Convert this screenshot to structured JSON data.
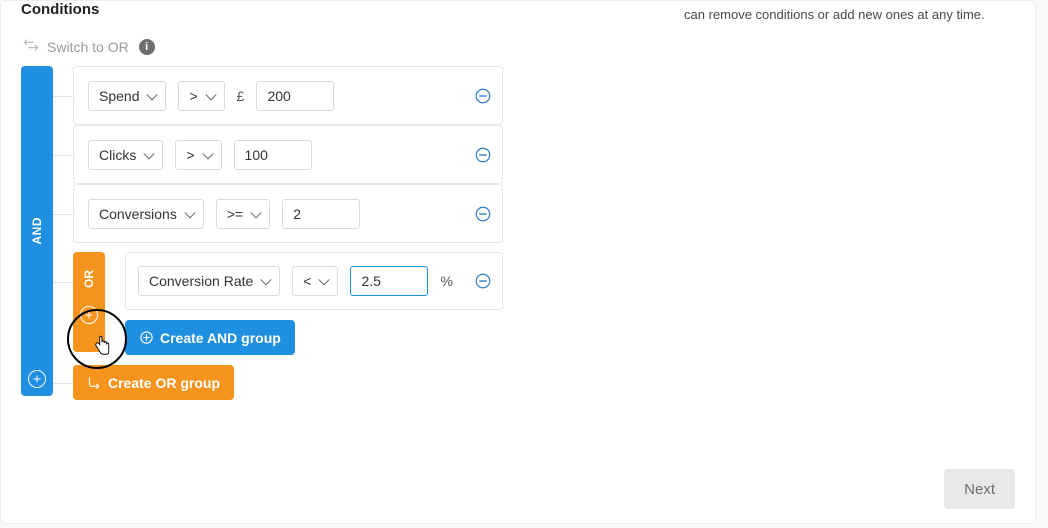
{
  "heading": "Conditions",
  "hint_text": "can remove conditions or add new ones at any time.",
  "switch_label": "Switch to OR",
  "and_label": "AND",
  "or_label": "OR",
  "currency_symbol": "£",
  "percent_symbol": "%",
  "rows": [
    {
      "metric": "Spend",
      "operator": ">",
      "value": "200",
      "prefix": "£"
    },
    {
      "metric": "Clicks",
      "operator": ">",
      "value": "100"
    },
    {
      "metric": "Conversions",
      "operator": ">=",
      "value": "2"
    }
  ],
  "or_group": {
    "rows": [
      {
        "metric": "Conversion Rate",
        "operator": "<",
        "value": "2.5",
        "suffix": "%"
      }
    ],
    "create_and_label": "Create AND group"
  },
  "create_or_label": "Create OR group",
  "next_label": "Next"
}
